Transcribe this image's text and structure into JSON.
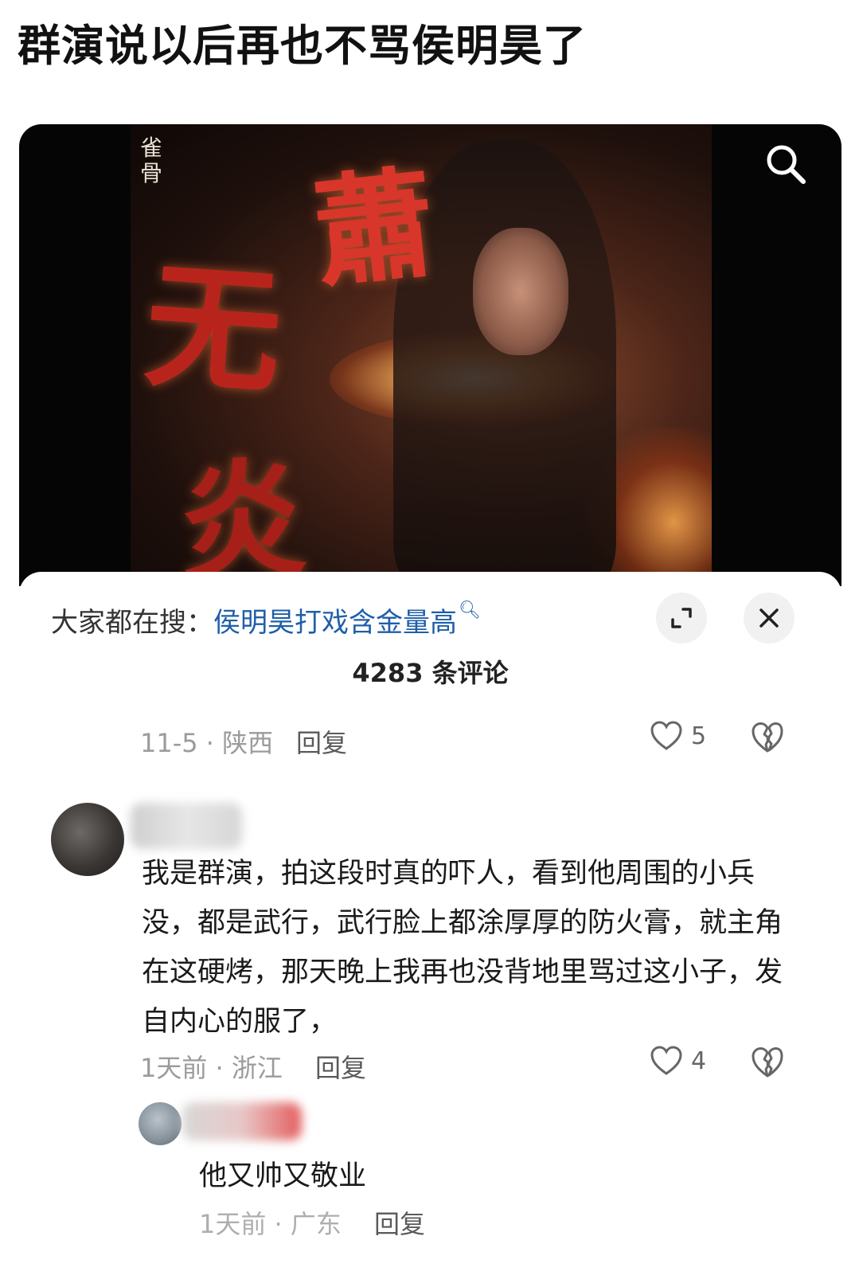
{
  "headline": "群演说以后再也不骂侯明昊了",
  "video": {
    "brush_chars": [
      "蕭",
      "无",
      "炎"
    ],
    "series_mark": "雀骨",
    "search_icon": "search-icon"
  },
  "panel": {
    "hot_search_prefix": "大家都在搜：",
    "hot_search_query": "侯明昊打戏含金量高",
    "comment_count": "4283 条评论",
    "expand_icon": "expand-icon",
    "close_icon": "close-icon"
  },
  "comments": [
    {
      "meta": "11-5 · 陕西",
      "reply_label": "回复",
      "likes": "5"
    },
    {
      "text": "我是群演，拍这段时真的吓人，看到他周围的小兵没，都是武行，武行脸上都涂厚厚的防火膏，就主角在这硬烤，那天晚上我再也没背地里骂过这小子，发自内心的服了，",
      "meta": "1天前 · 浙江",
      "reply_label": "回复",
      "likes": "4"
    },
    {
      "text": "他又帅又敬业",
      "meta": "1天前 · 广东",
      "reply_label": "回复"
    }
  ]
}
